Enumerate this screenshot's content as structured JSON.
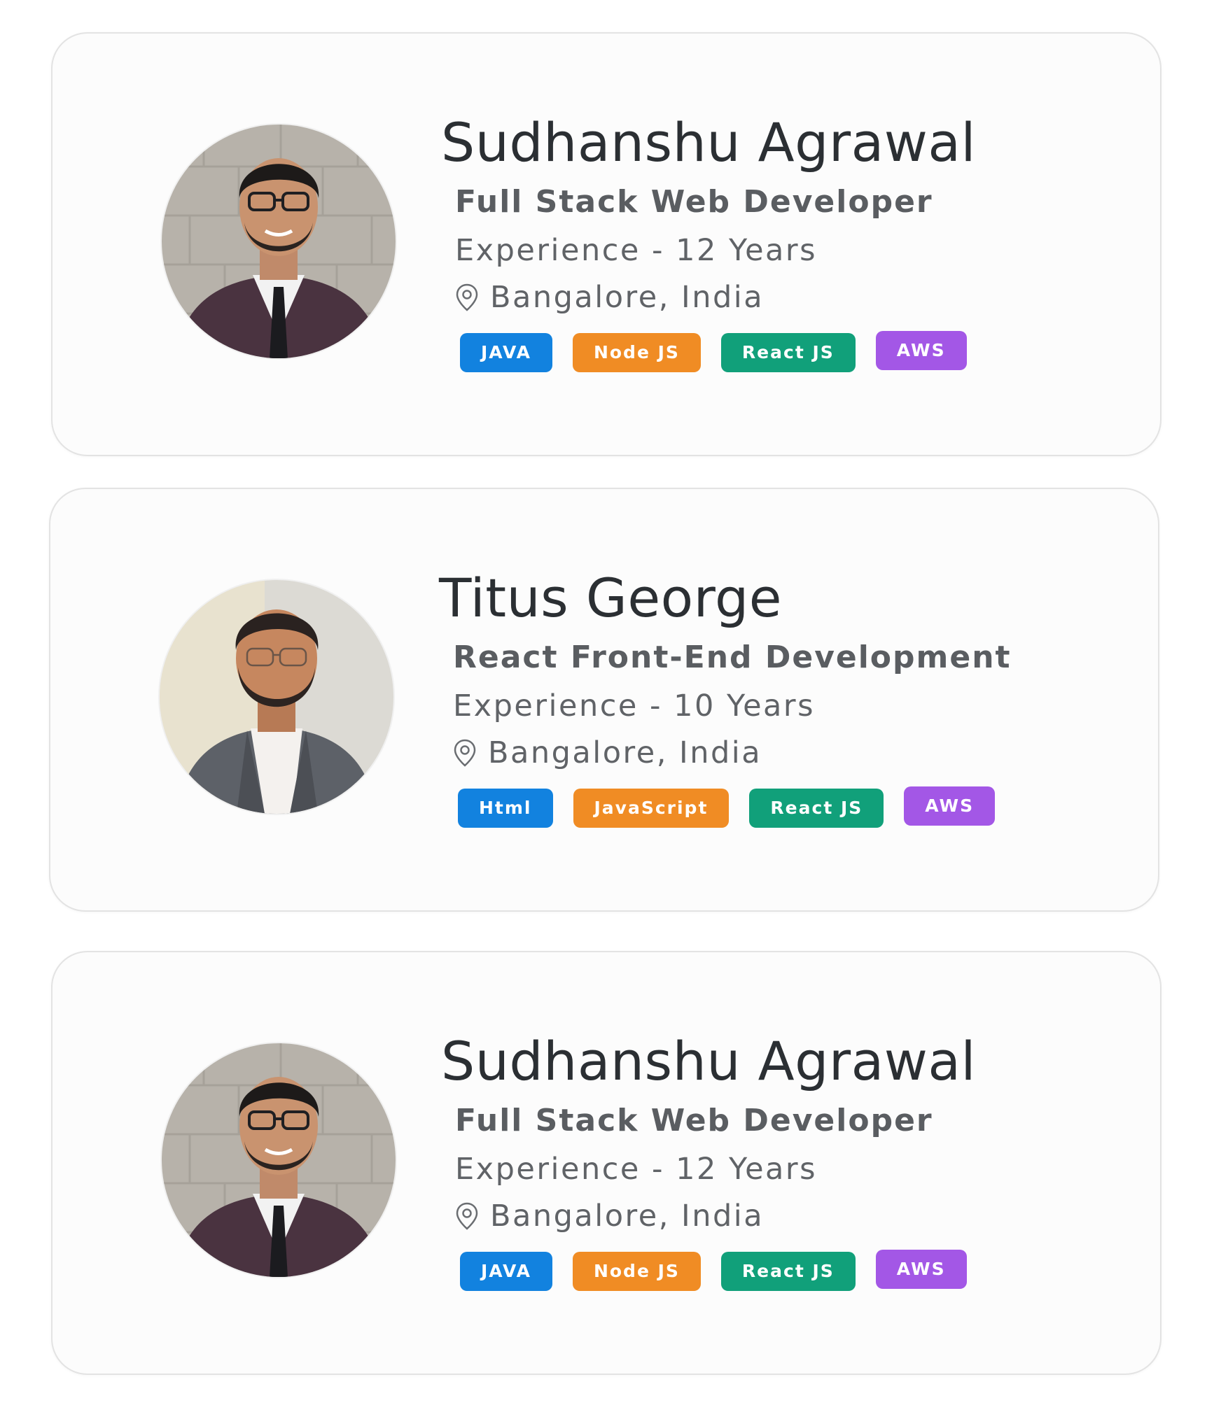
{
  "tag_colors": {
    "blue": "#1282df",
    "orange": "#f08c24",
    "green": "#11a07a",
    "purple": "#a357e6"
  },
  "cards": [
    {
      "name": "Sudhanshu Agrawal",
      "role": "Full Stack Web Developer",
      "experience": "Experience - 12 Years",
      "location": "Bangalore, India",
      "location_icon": "location-pin-icon",
      "avatar": "profile-photo-man-glasses-suit",
      "tags": [
        {
          "label": "JAVA",
          "color": "#1282df"
        },
        {
          "label": "Node JS",
          "color": "#f08c24"
        },
        {
          "label": "React JS",
          "color": "#11a07a"
        },
        {
          "label": "AWS",
          "color": "#a357e6"
        }
      ]
    },
    {
      "name": "Titus George",
      "role": "React Front-End Development",
      "experience": "Experience - 10 Years",
      "location": "Bangalore, India",
      "location_icon": "location-pin-icon",
      "avatar": "profile-photo-man-beard-blazer",
      "tags": [
        {
          "label": "Html",
          "color": "#1282df"
        },
        {
          "label": "JavaScript",
          "color": "#f08c24"
        },
        {
          "label": "React JS",
          "color": "#11a07a"
        },
        {
          "label": "AWS",
          "color": "#a357e6"
        }
      ]
    },
    {
      "name": "Sudhanshu Agrawal",
      "role": "Full Stack Web Developer",
      "experience": "Experience - 12 Years",
      "location": "Bangalore, India",
      "location_icon": "location-pin-icon",
      "avatar": "profile-photo-man-glasses-suit",
      "tags": [
        {
          "label": "JAVA",
          "color": "#1282df"
        },
        {
          "label": "Node JS",
          "color": "#f08c24"
        },
        {
          "label": "React JS",
          "color": "#11a07a"
        },
        {
          "label": "AWS",
          "color": "#a357e6"
        }
      ]
    }
  ]
}
